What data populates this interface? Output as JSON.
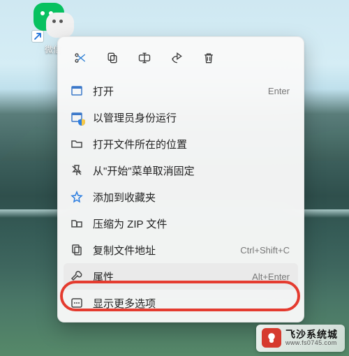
{
  "desktop": {
    "icon_label": "微信"
  },
  "action_bar": {
    "items": [
      {
        "name": "cut"
      },
      {
        "name": "copy"
      },
      {
        "name": "rename"
      },
      {
        "name": "share"
      },
      {
        "name": "delete"
      }
    ]
  },
  "menu": {
    "items": [
      {
        "icon": "open",
        "label": "打开",
        "shortcut": "Enter"
      },
      {
        "icon": "admin",
        "label": "以管理员身份运行",
        "shortcut": ""
      },
      {
        "icon": "folder",
        "label": "打开文件所在的位置",
        "shortcut": ""
      },
      {
        "icon": "unpin",
        "label": "从\"开始\"菜单取消固定",
        "shortcut": ""
      },
      {
        "icon": "star",
        "label": "添加到收藏夹",
        "shortcut": ""
      },
      {
        "icon": "zip",
        "label": "压缩为 ZIP 文件",
        "shortcut": ""
      },
      {
        "icon": "copypath",
        "label": "复制文件地址",
        "shortcut": "Ctrl+Shift+C"
      },
      {
        "icon": "wrench",
        "label": "属性",
        "shortcut": "Alt+Enter",
        "highlight": true
      },
      {
        "icon": "more",
        "label": "显示更多选项",
        "shortcut": ""
      }
    ]
  },
  "watermark": {
    "title": "飞沙系统城",
    "url": "www.fs0745.com"
  }
}
